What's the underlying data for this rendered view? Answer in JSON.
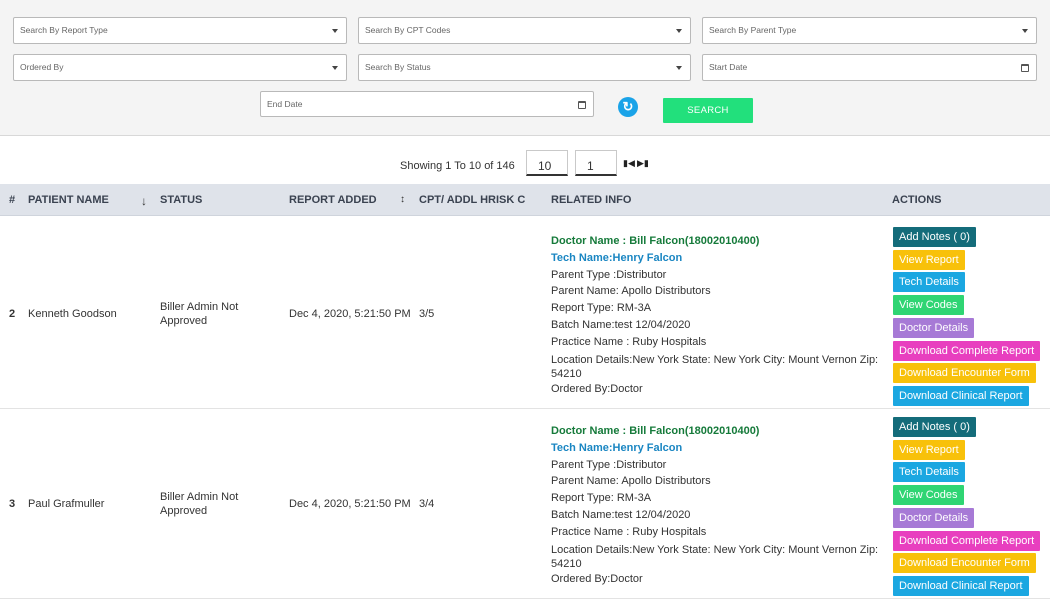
{
  "filters": {
    "report_type": "Search By Report Type",
    "cpt_codes": "Search By CPT Codes",
    "parent_type": "Search By Parent Type",
    "ordered_by": "Ordered By",
    "status": "Search By Status",
    "start_date": "Start Date",
    "end_date": "End Date",
    "search_label": "SEARCH"
  },
  "pagination": {
    "showing": "Showing 1 To 10 of 146",
    "page_size": "10",
    "page": "1",
    "first_icon": "⏮",
    "last_icon": "⏭"
  },
  "table": {
    "headers": {
      "index": "#",
      "patient": "PATIENT NAME",
      "status": "STATUS",
      "report_added": "REPORT ADDED",
      "cpt": "CPT/ ADDL HRISK C",
      "related": "RELATED INFO",
      "actions": "ACTIONS"
    },
    "rows": [
      {
        "index": "2",
        "patient": "Kenneth Goodson",
        "status_line1": "Biller Admin Not",
        "status_line2": "Approved",
        "report_added": "Dec 4, 2020, 5:21:50 PM",
        "cpt": "3/5",
        "doctor": "Doctor Name : Bill Falcon(18002010400)",
        "tech": "Tech Name:Henry Falcon",
        "parent_type": "Parent Type :Distributor",
        "parent_name": "Parent Name: Apollo Distributors",
        "report_type": "Report Type: RM-3A",
        "batch": "Batch Name:test 12/04/2020",
        "practice": "Practice Name : Ruby Hospitals",
        "location_line1": "Location Details:New York State: New York City: Mount Vernon Zip:",
        "location_line2": "54210",
        "ordered_by": "Ordered By:Doctor"
      },
      {
        "index": "3",
        "patient": "Paul Grafmuller",
        "status_line1": "Biller Admin Not",
        "status_line2": "Approved",
        "report_added": "Dec 4, 2020, 5:21:50 PM",
        "cpt": "3/4",
        "doctor": "Doctor Name : Bill Falcon(18002010400)",
        "tech": "Tech Name:Henry Falcon",
        "parent_type": "Parent Type :Distributor",
        "parent_name": "Parent Name: Apollo Distributors",
        "report_type": "Report Type: RM-3A",
        "batch": "Batch Name:test 12/04/2020",
        "practice": "Practice Name : Ruby Hospitals",
        "location_line1": "Location Details:New York State: New York City: Mount Vernon Zip:",
        "location_line2": "54210",
        "ordered_by": "Ordered By:Doctor"
      }
    ]
  },
  "actions": [
    {
      "label": "Add Notes ( 0)",
      "color": "#146c7a"
    },
    {
      "label": "View Report",
      "color": "#f8c10a"
    },
    {
      "label": "Tech Details",
      "color": "#1ba7e1"
    },
    {
      "label": "View Codes",
      "color": "#2fd573"
    },
    {
      "label": "Doctor Details",
      "color": "#a77ad6"
    },
    {
      "label": "Download Complete Report",
      "color": "#e83fbf"
    },
    {
      "label": "Download Encounter Form",
      "color": "#f8c10a"
    },
    {
      "label": "Download Clinical Report",
      "color": "#1ba7e1"
    }
  ]
}
